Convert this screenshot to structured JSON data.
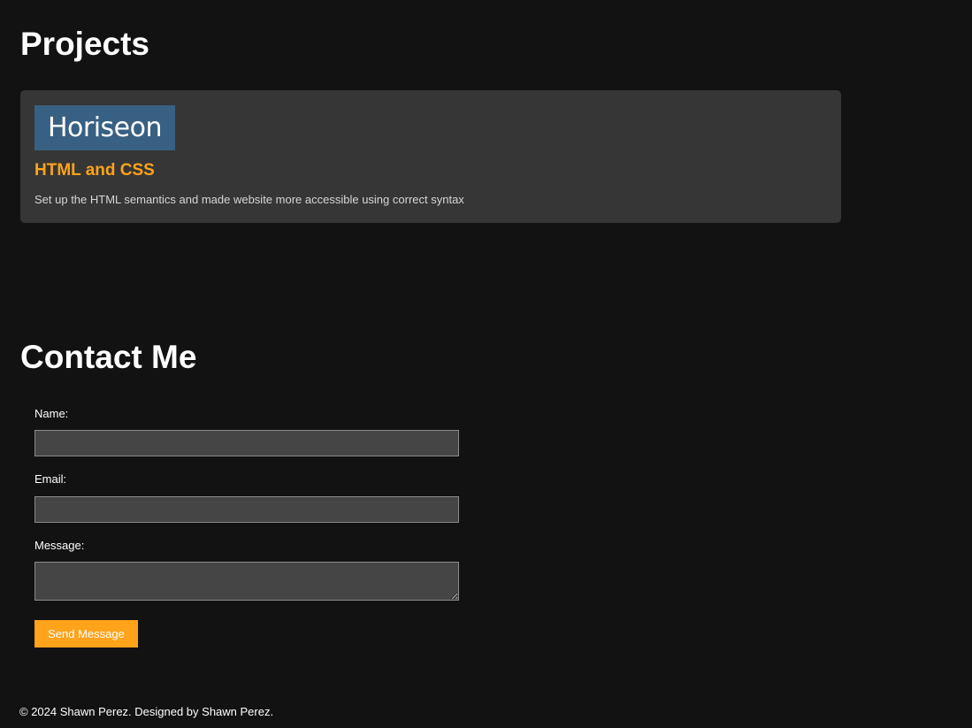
{
  "projects": {
    "title": "Projects",
    "items": [
      {
        "logo_text": "Horiseon",
        "title": "HTML and CSS",
        "description": "Set up the HTML semantics and made website more accessible using correct syntax"
      }
    ]
  },
  "contact": {
    "title": "Contact Me",
    "fields": {
      "name": {
        "label": "Name:",
        "value": ""
      },
      "email": {
        "label": "Email:",
        "value": ""
      },
      "message": {
        "label": "Message:",
        "value": ""
      }
    },
    "submit_label": "Send Message"
  },
  "footer": {
    "text": "© 2024 Shawn Perez. Designed by Shawn Perez."
  },
  "colors": {
    "background": "#121212",
    "card": "#363636",
    "accent": "#ffa31a",
    "logo_bg": "#386082",
    "input_bg": "#454545"
  }
}
